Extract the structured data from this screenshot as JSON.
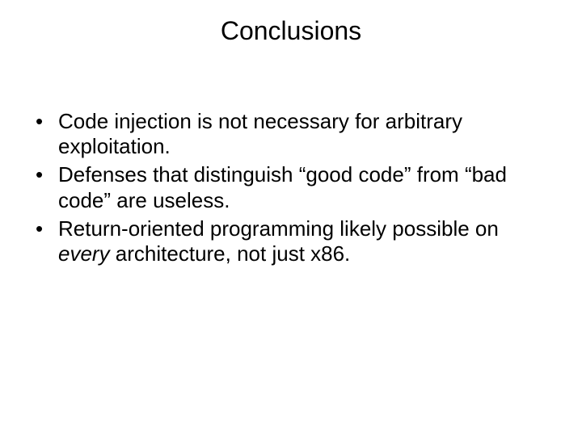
{
  "title": "Conclusions",
  "bullets": {
    "b1": "Code injection is not necessary for arbitrary exploitation.",
    "b2": "Defenses that distinguish “good code” from “bad code” are useless.",
    "b3_pre": "Return-oriented programming likely possible on ",
    "b3_em": "every",
    "b3_post": " architecture, not just x86."
  }
}
